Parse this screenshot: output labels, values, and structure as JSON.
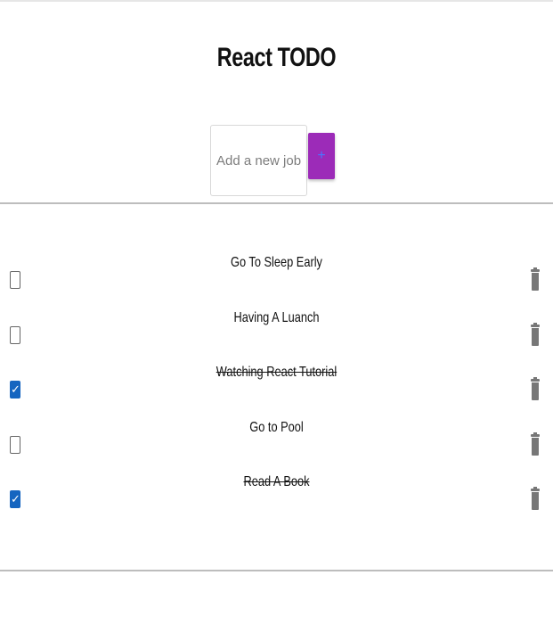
{
  "app": {
    "title": "React TODO"
  },
  "add_form": {
    "placeholder": "Add a new job",
    "value": "",
    "button_label": "+"
  },
  "colors": {
    "accent": "#9c2bb8",
    "checkbox_checked": "#1565c0"
  },
  "todos": [
    {
      "text": "Go To Sleep Early",
      "done": false
    },
    {
      "text": "Having A Luanch",
      "done": false
    },
    {
      "text": "Watching React Tutorial",
      "done": true
    },
    {
      "text": "Go to Pool",
      "done": false
    },
    {
      "text": "Read A Book",
      "done": true
    }
  ],
  "icons": {
    "delete": "trash-icon",
    "checkbox": "checkbox-icon"
  }
}
